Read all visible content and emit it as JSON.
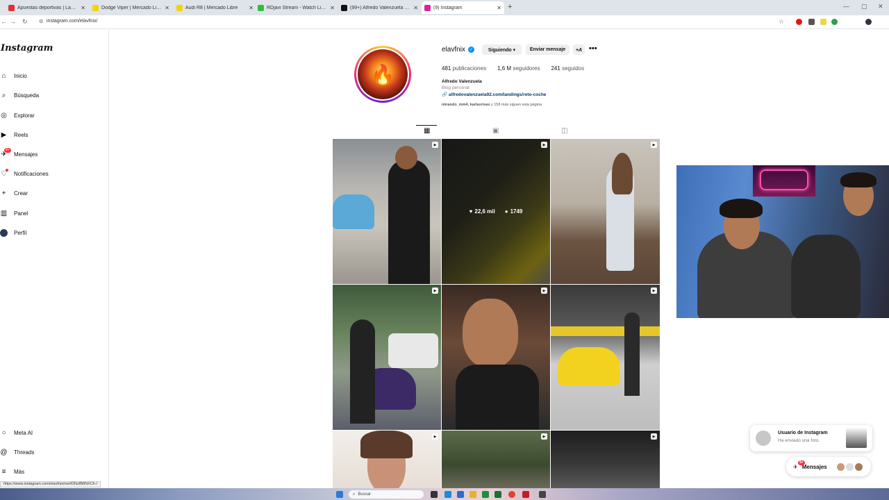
{
  "browser": {
    "tabs": [
      {
        "title": "Apuestas deportivas | Las mejo",
        "color": "#e03030",
        "active": false
      },
      {
        "title": "Dodge Viper | Mercado Libre",
        "color": "#f2d600",
        "active": false
      },
      {
        "title": "Audi R8 | Mercado Libre",
        "color": "#f2d600",
        "active": false
      },
      {
        "title": "RDjavi Stream - Watch Live on",
        "color": "#2fbf3a",
        "active": false
      },
      {
        "title": "(99+) Alfredo Valenzuela (@vip",
        "color": "#111111",
        "active": false
      },
      {
        "title": "(9) Instagram",
        "color": "#d6249f",
        "active": true
      }
    ],
    "new_tab": "+",
    "url": "instagram.com/elavfnix/"
  },
  "sidebar": {
    "logo": "Instagram",
    "items": [
      {
        "label": "Inicio",
        "icon": "home-icon",
        "glyph": "⌂"
      },
      {
        "label": "Búsqueda",
        "icon": "search-icon",
        "glyph": "⌕"
      },
      {
        "label": "Explorar",
        "icon": "compass-icon",
        "glyph": "◎"
      },
      {
        "label": "Reels",
        "icon": "reels-icon",
        "glyph": "▶"
      },
      {
        "label": "Mensajes",
        "icon": "messenger-icon",
        "glyph": "✈",
        "badge": "9+"
      },
      {
        "label": "Notificaciones",
        "icon": "heart-icon",
        "glyph": "♡",
        "dot": true
      },
      {
        "label": "Crear",
        "icon": "plus-icon",
        "glyph": "+"
      },
      {
        "label": "Panel",
        "icon": "panel-icon",
        "glyph": "▥"
      },
      {
        "label": "Perfil",
        "icon": "profile-avatar",
        "glyph": ""
      }
    ],
    "bottom": [
      {
        "label": "Meta AI",
        "icon": "meta-ai-icon",
        "glyph": "○"
      },
      {
        "label": "Threads",
        "icon": "threads-icon",
        "glyph": "@"
      },
      {
        "label": "Más",
        "icon": "menu-icon",
        "glyph": "≡"
      }
    ]
  },
  "profile": {
    "username": "elavfnix",
    "following_btn": "Siguiendo ▾",
    "message_btn": "Enviar mensaje",
    "add_user": "+𝘈",
    "more": "•••",
    "posts_count": "481",
    "posts_label": "publicaciones",
    "followers_count": "1,6 M",
    "followers_label": "seguidores",
    "following_count": "241",
    "following_label": "seguidos",
    "name": "Alfredo Valenzuela",
    "category": "Blog personal",
    "link": "alfredovalenzuela92.com/landings/reto-coche",
    "followed_by_names": "mirando_mm4, karlaxrivas",
    "followed_by_rest": " y 158 más siguen esta página"
  },
  "grid_hover": {
    "likes": "22,6 mil",
    "comments": "1749"
  },
  "notification": {
    "title": "Usuario de Instagram",
    "text": "Ha enviado una foto."
  },
  "messages_pill": {
    "label": "Mensajes",
    "badge": "9+"
  },
  "status_url": "https://www.instagram.com/elavfnix/reel/DNzfB8NXCh-/",
  "taskbar": {
    "search": "Buscar"
  }
}
